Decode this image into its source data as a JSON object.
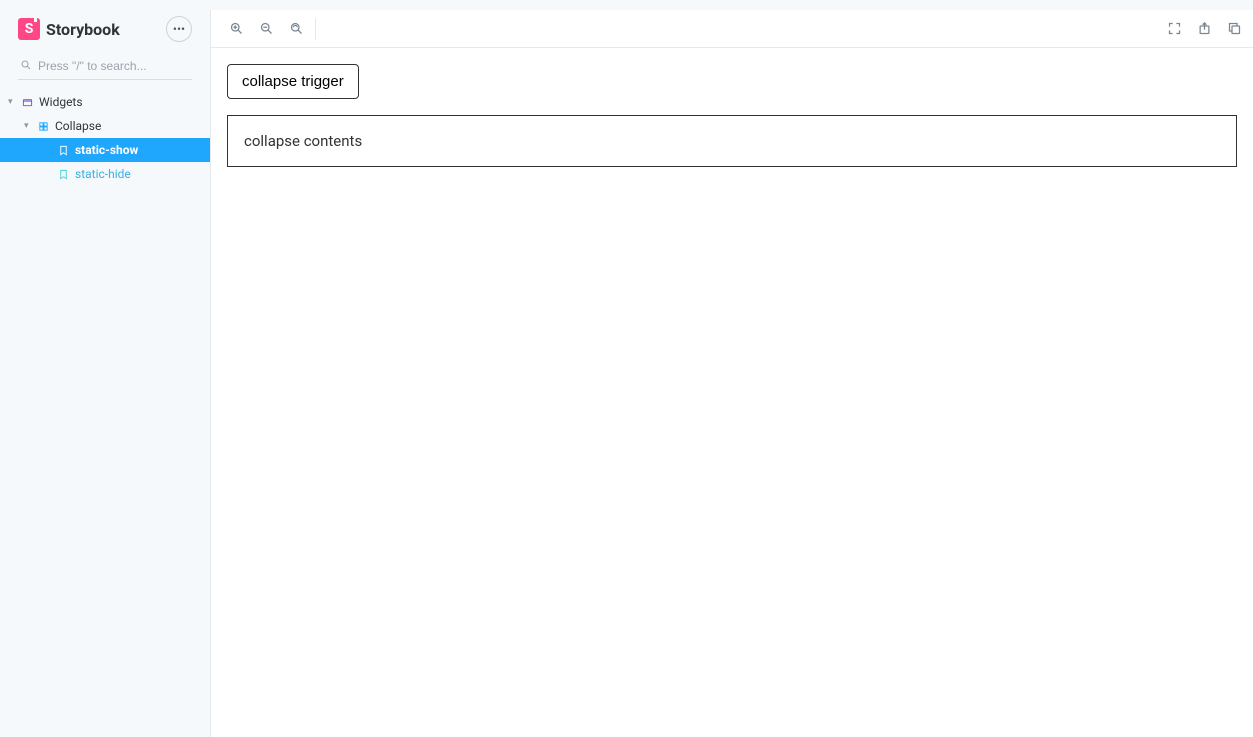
{
  "brand": {
    "name": "Storybook",
    "mark": "S"
  },
  "search": {
    "placeholder": "Press \"/\" to search..."
  },
  "tree": {
    "root": {
      "label": "Widgets"
    },
    "component": {
      "label": "Collapse"
    },
    "stories": [
      {
        "id": "static-show",
        "label": "static-show",
        "active": true
      },
      {
        "id": "static-hide",
        "label": "static-hide",
        "active": false
      }
    ]
  },
  "preview": {
    "trigger_label": "collapse trigger",
    "contents_label": "collapse contents"
  }
}
